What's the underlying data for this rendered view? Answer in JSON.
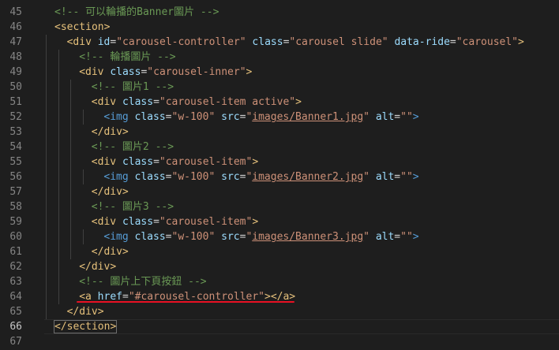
{
  "editor": {
    "lines": [
      {
        "n": "45",
        "indent": 0,
        "segments": [
          {
            "t": "cmt",
            "v": "<!-- 可以輪播的Banner圖片 -->"
          }
        ]
      },
      {
        "n": "46",
        "indent": 0,
        "segments": [
          {
            "t": "kw",
            "v": "<section>"
          }
        ]
      },
      {
        "n": "47",
        "indent": 1,
        "segments": [
          {
            "t": "kw",
            "v": "<div "
          },
          {
            "t": "attr",
            "v": "id"
          },
          {
            "t": "text",
            "v": "="
          },
          {
            "t": "val",
            "v": "\"carousel-controller\""
          },
          {
            "t": "text",
            "v": " "
          },
          {
            "t": "attr",
            "v": "class"
          },
          {
            "t": "text",
            "v": "="
          },
          {
            "t": "val",
            "v": "\"carousel slide\""
          },
          {
            "t": "text",
            "v": " "
          },
          {
            "t": "attr",
            "v": "data-ride"
          },
          {
            "t": "text",
            "v": "="
          },
          {
            "t": "val",
            "v": "\"carousel\""
          },
          {
            "t": "kw",
            "v": ">"
          }
        ]
      },
      {
        "n": "48",
        "indent": 2,
        "segments": [
          {
            "t": "cmt",
            "v": "<!-- 輪播圖片 -->"
          }
        ]
      },
      {
        "n": "49",
        "indent": 2,
        "segments": [
          {
            "t": "kw",
            "v": "<div "
          },
          {
            "t": "attr",
            "v": "class"
          },
          {
            "t": "text",
            "v": "="
          },
          {
            "t": "val",
            "v": "\"carousel-inner\""
          },
          {
            "t": "kw",
            "v": ">"
          }
        ]
      },
      {
        "n": "50",
        "indent": 3,
        "segments": [
          {
            "t": "cmt",
            "v": "<!-- 圖片1 -->"
          }
        ]
      },
      {
        "n": "51",
        "indent": 3,
        "segments": [
          {
            "t": "kw",
            "v": "<div "
          },
          {
            "t": "attr",
            "v": "class"
          },
          {
            "t": "text",
            "v": "="
          },
          {
            "t": "val",
            "v": "\"carousel-item active\""
          },
          {
            "t": "kw",
            "v": ">"
          }
        ]
      },
      {
        "n": "52",
        "indent": 4,
        "segments": [
          {
            "t": "blue",
            "v": "<img "
          },
          {
            "t": "attr",
            "v": "class"
          },
          {
            "t": "text",
            "v": "="
          },
          {
            "t": "val",
            "v": "\"w-100\""
          },
          {
            "t": "text",
            "v": " "
          },
          {
            "t": "attr",
            "v": "src"
          },
          {
            "t": "text",
            "v": "="
          },
          {
            "t": "val",
            "v": "\""
          },
          {
            "t": "link",
            "v": "images/Banner1.jpg"
          },
          {
            "t": "val",
            "v": "\""
          },
          {
            "t": "text",
            "v": " "
          },
          {
            "t": "attr",
            "v": "alt"
          },
          {
            "t": "text",
            "v": "="
          },
          {
            "t": "val",
            "v": "\"\""
          },
          {
            "t": "blue",
            "v": ">"
          }
        ]
      },
      {
        "n": "53",
        "indent": 3,
        "segments": [
          {
            "t": "kw",
            "v": "</div>"
          }
        ]
      },
      {
        "n": "54",
        "indent": 3,
        "segments": [
          {
            "t": "cmt",
            "v": "<!-- 圖片2 -->"
          }
        ]
      },
      {
        "n": "55",
        "indent": 3,
        "segments": [
          {
            "t": "kw",
            "v": "<div "
          },
          {
            "t": "attr",
            "v": "class"
          },
          {
            "t": "text",
            "v": "="
          },
          {
            "t": "val",
            "v": "\"carousel-item\""
          },
          {
            "t": "kw",
            "v": ">"
          }
        ]
      },
      {
        "n": "56",
        "indent": 4,
        "segments": [
          {
            "t": "blue",
            "v": "<img "
          },
          {
            "t": "attr",
            "v": "class"
          },
          {
            "t": "text",
            "v": "="
          },
          {
            "t": "val",
            "v": "\"w-100\""
          },
          {
            "t": "text",
            "v": " "
          },
          {
            "t": "attr",
            "v": "src"
          },
          {
            "t": "text",
            "v": "="
          },
          {
            "t": "val",
            "v": "\""
          },
          {
            "t": "link",
            "v": "images/Banner2.jpg"
          },
          {
            "t": "val",
            "v": "\""
          },
          {
            "t": "text",
            "v": " "
          },
          {
            "t": "attr",
            "v": "alt"
          },
          {
            "t": "text",
            "v": "="
          },
          {
            "t": "val",
            "v": "\"\""
          },
          {
            "t": "blue",
            "v": ">"
          }
        ]
      },
      {
        "n": "57",
        "indent": 3,
        "segments": [
          {
            "t": "kw",
            "v": "</div>"
          }
        ]
      },
      {
        "n": "58",
        "indent": 3,
        "segments": [
          {
            "t": "cmt",
            "v": "<!-- 圖片3 -->"
          }
        ]
      },
      {
        "n": "59",
        "indent": 3,
        "segments": [
          {
            "t": "kw",
            "v": "<div "
          },
          {
            "t": "attr",
            "v": "class"
          },
          {
            "t": "text",
            "v": "="
          },
          {
            "t": "val",
            "v": "\"carousel-item\""
          },
          {
            "t": "kw",
            "v": ">"
          }
        ]
      },
      {
        "n": "60",
        "indent": 4,
        "segments": [
          {
            "t": "blue",
            "v": "<img "
          },
          {
            "t": "attr",
            "v": "class"
          },
          {
            "t": "text",
            "v": "="
          },
          {
            "t": "val",
            "v": "\"w-100\""
          },
          {
            "t": "text",
            "v": " "
          },
          {
            "t": "attr",
            "v": "src"
          },
          {
            "t": "text",
            "v": "="
          },
          {
            "t": "val",
            "v": "\""
          },
          {
            "t": "link",
            "v": "images/Banner3.jpg"
          },
          {
            "t": "val",
            "v": "\""
          },
          {
            "t": "text",
            "v": " "
          },
          {
            "t": "attr",
            "v": "alt"
          },
          {
            "t": "text",
            "v": "="
          },
          {
            "t": "val",
            "v": "\"\""
          },
          {
            "t": "blue",
            "v": ">"
          }
        ]
      },
      {
        "n": "61",
        "indent": 3,
        "segments": [
          {
            "t": "kw",
            "v": "</div>"
          }
        ]
      },
      {
        "n": "62",
        "indent": 2,
        "segments": [
          {
            "t": "kw",
            "v": "</div>"
          }
        ]
      },
      {
        "n": "63",
        "indent": 2,
        "segments": [
          {
            "t": "cmt",
            "v": "<!-- 圖片上下頁按鈕 -->"
          }
        ]
      },
      {
        "n": "64",
        "indent": 2,
        "segments": [
          {
            "t": "kw",
            "v": "<a "
          },
          {
            "t": "attr",
            "v": "href"
          },
          {
            "t": "text",
            "v": "="
          },
          {
            "t": "val",
            "v": "\"#carousel-controller\""
          },
          {
            "t": "kw",
            "v": "></a>"
          }
        ]
      },
      {
        "n": "65",
        "indent": 1,
        "segments": [
          {
            "t": "kw",
            "v": "</div>"
          }
        ]
      },
      {
        "n": "66",
        "indent": 0,
        "active": true,
        "segments": [
          {
            "t": "kw",
            "v": "</section>"
          }
        ]
      },
      {
        "n": "67",
        "indent": 0,
        "segments": []
      }
    ]
  },
  "colors": {
    "background": "#1e1e1e",
    "tag": "#e5c07b",
    "blue_tag": "#569cd6",
    "attribute": "#9cdcfe",
    "string": "#ce9178",
    "comment": "#6a9955",
    "line_number": "#858585",
    "underline_annotation": "#e81123"
  }
}
